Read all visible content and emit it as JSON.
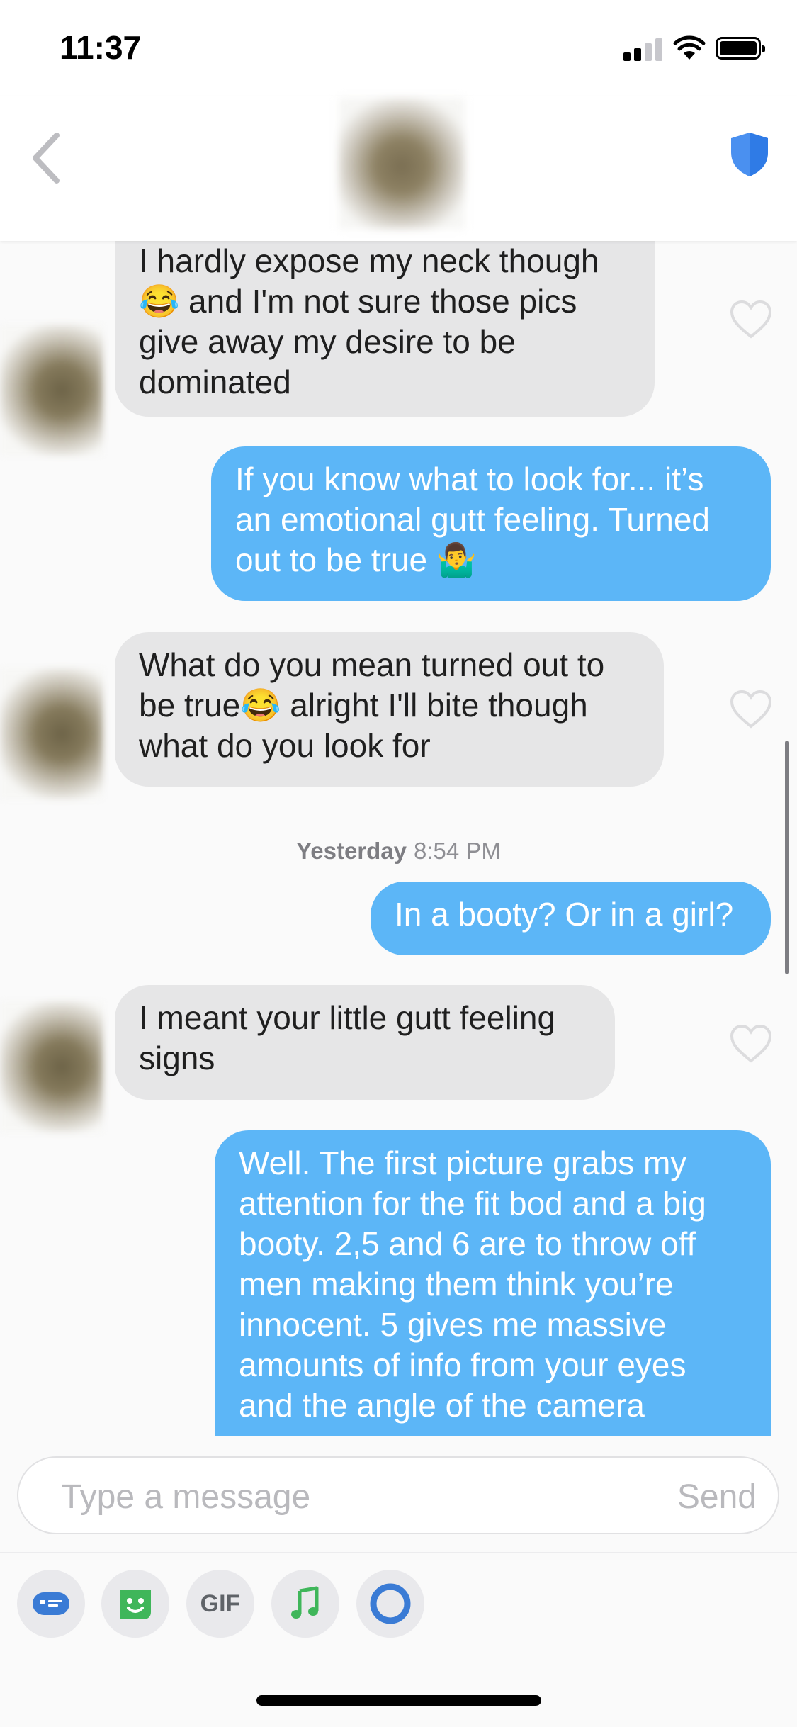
{
  "status_bar": {
    "time": "11:37"
  },
  "header": {
    "title": ""
  },
  "messages": [
    {
      "from": "them",
      "text": "I hardly expose my neck though\n😂 and I'm not sure those pics\ngive away my desire to be\ndominated"
    },
    {
      "from": "me",
      "text": "If you know what to look for... it’s\nan emotional gutt feeling. Turned\nout to be true 🤷‍♂️"
    },
    {
      "from": "them",
      "text": "What do you mean turned out to\nbe true😂 alright I'll bite though\nwhat do you look for"
    },
    {
      "from": "me",
      "text": "In a booty? Or in a girl?"
    },
    {
      "from": "them",
      "text": "I meant your little gutt feeling\nsigns"
    },
    {
      "from": "me",
      "text": "Well. The first picture grabs my\nattention for the fit bod and a big\nbooty. 2,5 and 6 are to throw off\nmen making them think you’re\ninnocent. 5 gives me massive\namounts of info from your eyes\nand the angle of the camera"
    }
  ],
  "timestamp": {
    "day": "Yesterday",
    "time": "8:54 PM"
  },
  "composer": {
    "placeholder": "Type a message",
    "send_label": "Send",
    "tools": [
      {
        "icon": "bitmoji-keyboard-icon"
      },
      {
        "icon": "sticker-icon"
      },
      {
        "icon": "gif-icon",
        "label": "GIF"
      },
      {
        "icon": "music-icon"
      },
      {
        "icon": "loops-icon"
      }
    ]
  },
  "colors": {
    "accent": "#5cb6f7",
    "received": "#e6e6e7",
    "shield": "#4a90f0"
  }
}
